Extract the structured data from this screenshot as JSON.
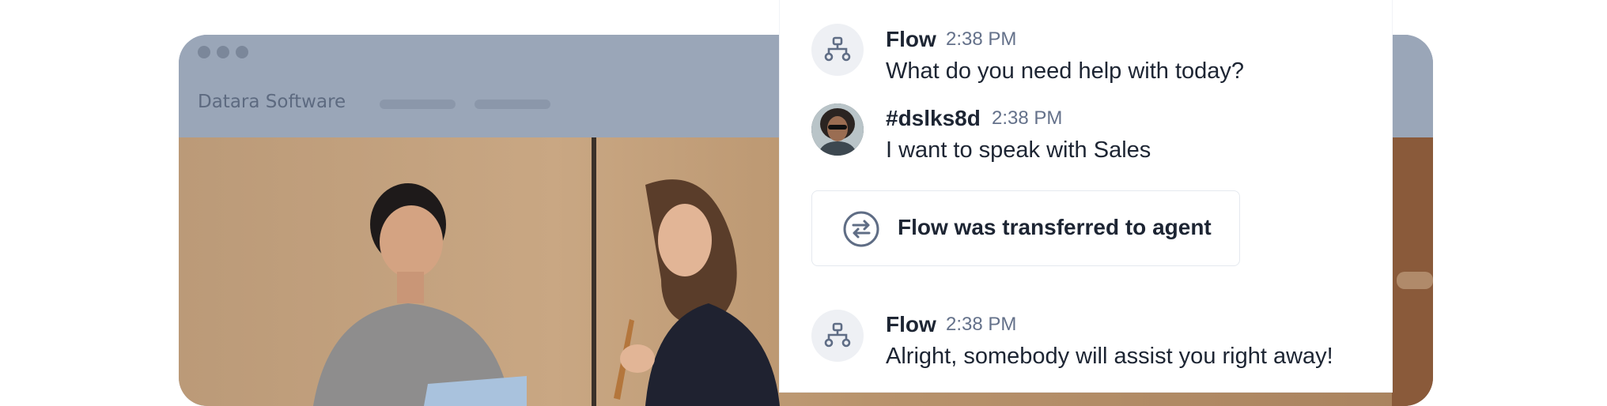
{
  "browser": {
    "brand": "Datara Software"
  },
  "chat": {
    "messages": [
      {
        "sender": "Flow",
        "time": "2:38 PM",
        "text": "What do you need help with today?",
        "avatar_icon": "flow-bot-icon"
      },
      {
        "sender": "#dslks8d",
        "time": "2:38 PM",
        "text": "I want to speak with Sales",
        "avatar_icon": "user-avatar"
      },
      {
        "sender": "Flow",
        "time": "2:38 PM",
        "text": "Alright, somebody will assist you right away!",
        "avatar_icon": "flow-bot-icon"
      }
    ],
    "transfer_notice": "Flow was transferred to agent",
    "transfer_icon": "transfer-arrows-icon"
  },
  "colors": {
    "panel_bg": "#ffffff",
    "text": "#1d2533",
    "muted": "#64718a",
    "browser_overlay": "#9aa6b8"
  }
}
